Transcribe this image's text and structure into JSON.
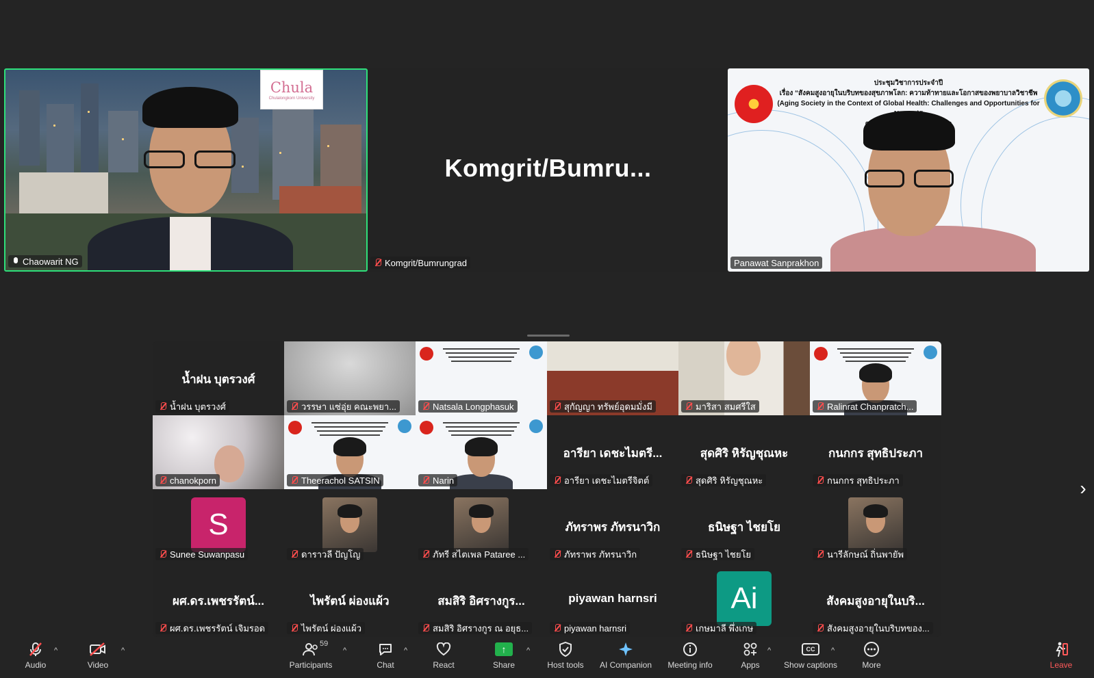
{
  "top_speakers": [
    {
      "name": "Chaowarit NG",
      "muted": false,
      "logo": {
        "word": "Chula",
        "sub": "Chulalongkorn University"
      }
    },
    {
      "name": "Komgrit/Bumrungrad",
      "muted": true,
      "display_name": "Komgrit/Bumru..."
    },
    {
      "name": "Panawat Sanprakhon",
      "muted": false,
      "slide": {
        "line1": "ประชุมวิชาการประจำปี",
        "line2": "เรื่อง “สังคมสูงอายุในบริบทของสุขภาพโลก: ความท้าทายและโอกาสของพยาบาลวิชาชีพ",
        "line3": "(Aging Society in the Context of Global Health: Challenges and Opportunities for Nurses)”",
        "line4": "คณะพยาบาลศ... ...ัยสวนดุสิต"
      }
    }
  ],
  "gallery": [
    [
      {
        "label": "น้ำฝน บุตรวงศ์",
        "display": "น้ำฝน บุตรวงศ์",
        "kind": "name"
      },
      {
        "label": "วรรษา แซ่อุ่ย คณะพยา...",
        "kind": "blur"
      },
      {
        "label": "Natsala Longphasuk",
        "kind": "slide"
      },
      {
        "label": "สุกัญญา ทรัพย์อุดมมั่งมี",
        "kind": "shelf"
      },
      {
        "label": "มาริสา สมศรีใส",
        "kind": "girl"
      },
      {
        "label": "Ralinrat Chanpratch...",
        "kind": "slide-person"
      }
    ],
    [
      {
        "label": "chanokporn",
        "kind": "blossom"
      },
      {
        "label": "Theerachol SATSIN",
        "kind": "slide-person"
      },
      {
        "label": "Narin",
        "kind": "slide-person"
      },
      {
        "label": "อารียา เดชะไมตรีจิตต์",
        "display": "อารียา เดชะไมตรี...",
        "kind": "name"
      },
      {
        "label": "สุดศิริ หิรัญชุณหะ",
        "display": "สุดศิริ หิรัญชุณหะ",
        "kind": "name"
      },
      {
        "label": "กนกกร สุทธิประภา",
        "display": "กนกกร สุทธิประภา",
        "kind": "name"
      }
    ],
    [
      {
        "label": "Sunee Suwanpasu",
        "kind": "letter",
        "letter": "S",
        "color": "#c8246b"
      },
      {
        "label": "ดาราวลี ปัญโญ",
        "kind": "photo"
      },
      {
        "label": "ภัทรี สไตเพล Pataree ...",
        "kind": "photo"
      },
      {
        "label": "ภัทราพร ภัทรนาวิก",
        "display": "ภัทราพร ภัทรนาวิก",
        "kind": "name"
      },
      {
        "label": "ธนิษฐา ไชยโย",
        "display": "ธนิษฐา ไชยโย",
        "kind": "name"
      },
      {
        "label": "นารีลักษณ์ ถิ่นพายัพ",
        "kind": "photo"
      }
    ],
    [
      {
        "label": "ผศ.ดร.เพชรรัตน์ เจิมรอด",
        "display": "ผศ.ดร.เพชรรัตน์...",
        "kind": "name"
      },
      {
        "label": "ไพรัตน์ ผ่องแผ้ว",
        "display": "ไพรัตน์ ผ่องแผ้ว",
        "kind": "name"
      },
      {
        "label": "สมสิริ อิศรางกูร ณ อยุธ...",
        "display": "สมสิริ อิศรางกูร...",
        "kind": "name"
      },
      {
        "label": "piyawan harnsri",
        "display": "piyawan harnsri",
        "kind": "name"
      },
      {
        "label": "เกษมาลี พึ่งเกษ",
        "kind": "letter",
        "letter": "Ai",
        "color": "#0d9a84"
      },
      {
        "label": "สังคมสูงอายุในบริบทของ...",
        "display": "สังคมสูงอายุในบริ...",
        "kind": "name"
      }
    ]
  ],
  "toolbar": {
    "audio": "Audio",
    "video": "Video",
    "participants": "Participants",
    "participants_count": "59",
    "chat": "Chat",
    "react": "React",
    "share": "Share",
    "host_tools": "Host tools",
    "ai_companion": "AI Companion",
    "meeting_info": "Meeting info",
    "apps": "Apps",
    "show_captions": "Show captions",
    "more": "More",
    "leave": "Leave"
  },
  "colors": {
    "active_speaker_border": "#2ee07a",
    "muted_red": "#ff4d4d",
    "share_green": "#22b14c"
  }
}
